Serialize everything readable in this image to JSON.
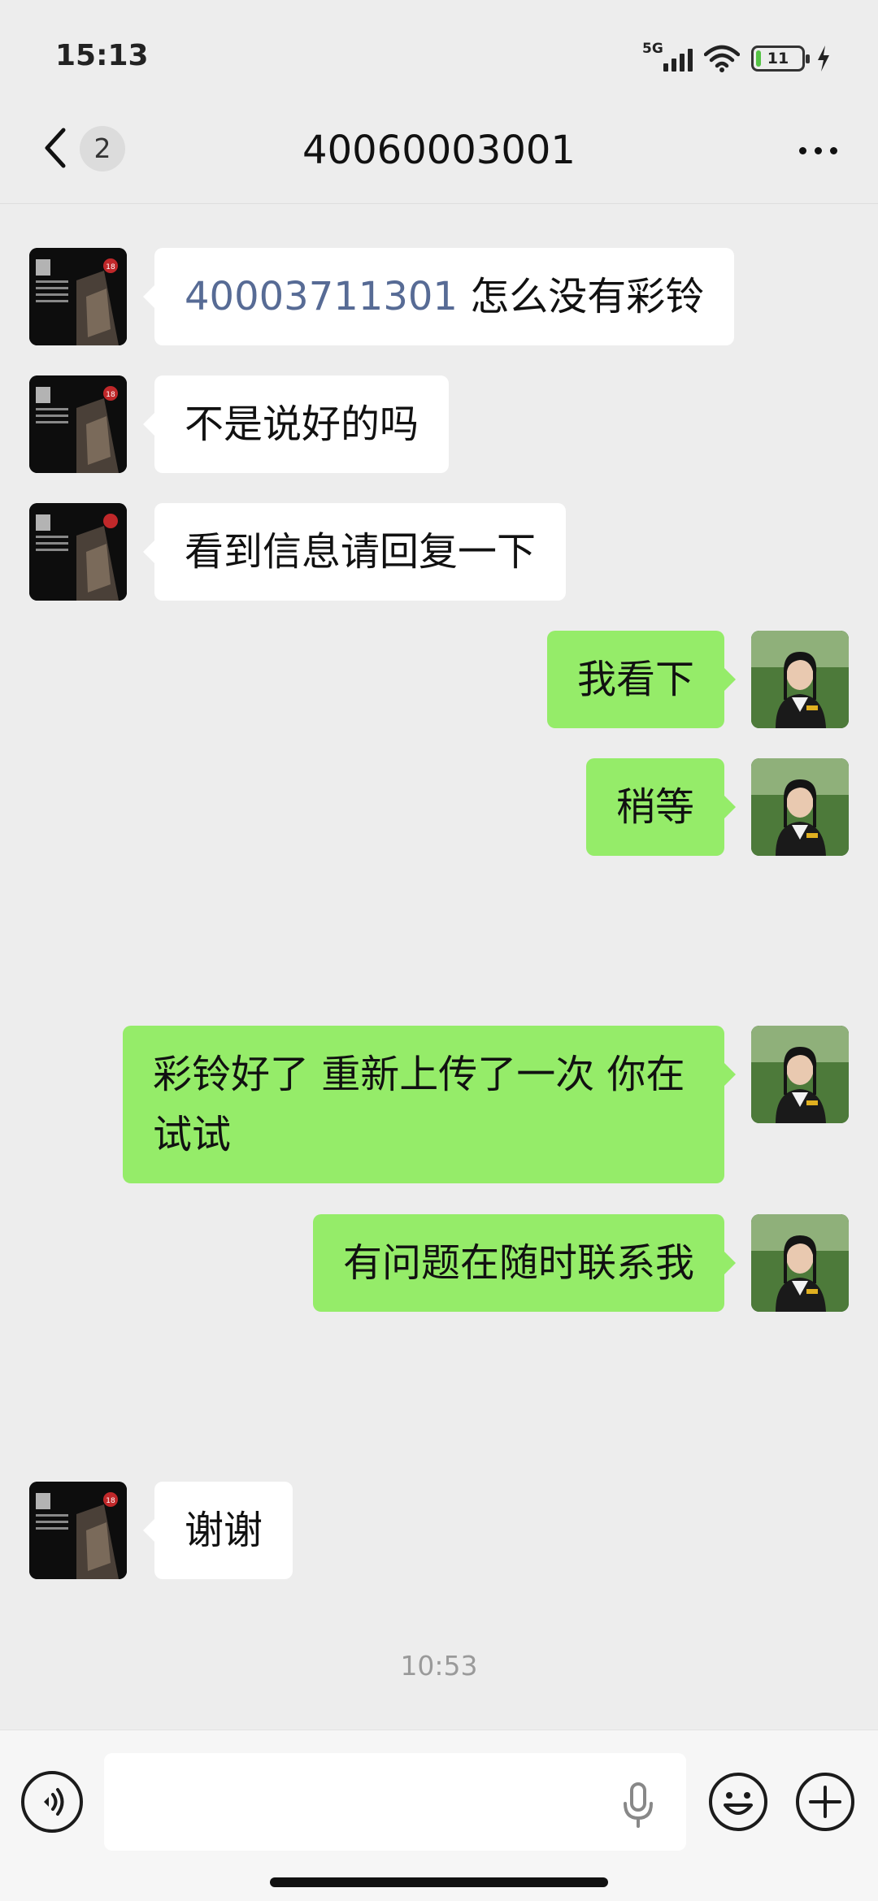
{
  "status_bar": {
    "time": "15:13",
    "network": "5G",
    "battery_level": "11",
    "battery_fraction": 0.11,
    "icons": [
      "signal-icon",
      "wifi-icon",
      "battery-icon",
      "charging-icon"
    ]
  },
  "nav": {
    "back_icon": "chevron-left-icon",
    "unread_count": "2",
    "title": "40060003001",
    "more_icon": "more-dots-icon"
  },
  "messages": [
    {
      "side": "in",
      "number": "40003711301",
      "text": " 怎么没有彩铃"
    },
    {
      "side": "in",
      "text": "不是说好的吗"
    },
    {
      "side": "in",
      "text": "看到信息请回复一下"
    },
    {
      "side": "out",
      "text": "我看下"
    },
    {
      "side": "out",
      "text": "稍等"
    },
    {
      "side": "out",
      "text": "彩铃好了  重新上传了一次 你在试试"
    },
    {
      "side": "out",
      "text": "有问题在随时联系我"
    },
    {
      "side": "in",
      "text": "谢谢"
    }
  ],
  "timestamp": "10:53",
  "input_bar": {
    "value": "",
    "placeholder": "",
    "icons": [
      "voice-icon",
      "mic-icon",
      "emoji-icon",
      "plus-icon"
    ]
  },
  "colors": {
    "background": "#ededed",
    "incoming_bubble": "#ffffff",
    "outgoing_bubble": "#95ec69",
    "link": "#576b95"
  }
}
